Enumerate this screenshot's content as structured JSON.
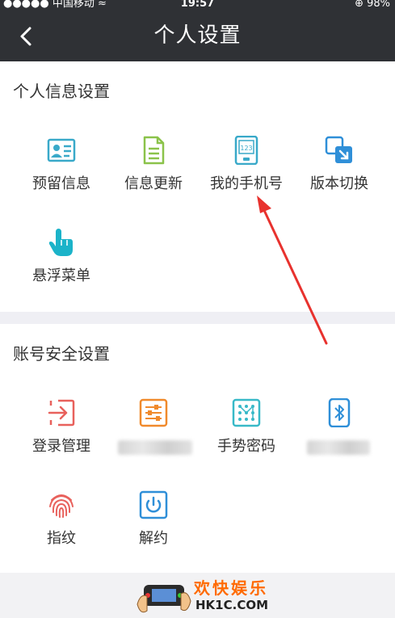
{
  "status_bar": {
    "signal": "●●●●● 中国移动 ≈",
    "time": "19:57",
    "battery": "⊕ 98%"
  },
  "nav": {
    "back_icon": "chevron-left-icon",
    "title": "个人设置"
  },
  "personal_section": {
    "title": "个人信息设置",
    "items": [
      {
        "label": "预留信息",
        "icon": "id-card-icon",
        "color": "#39a9c9"
      },
      {
        "label": "信息更新",
        "icon": "document-icon",
        "color": "#8bc34a"
      },
      {
        "label": "我的手机号",
        "icon": "phone-number-icon",
        "color": "#39a9c9"
      },
      {
        "label": "版本切换",
        "icon": "switch-version-icon",
        "color": "#2f8fd8"
      },
      {
        "label": "悬浮菜单",
        "icon": "hand-pointer-icon",
        "color": "#1bb3c9"
      }
    ]
  },
  "security_section": {
    "title": "账号安全设置",
    "items": [
      {
        "label": "登录管理",
        "icon": "login-icon",
        "color": "#e8615c"
      },
      {
        "label": "",
        "icon": "sliders-icon",
        "color": "#f08a2c"
      },
      {
        "label": "手势密码",
        "icon": "gesture-grid-icon",
        "color": "#38b9c8"
      },
      {
        "label": "",
        "icon": "bluetooth-icon",
        "color": "#2f8fd8"
      },
      {
        "label": "指纹",
        "icon": "fingerprint-icon",
        "color": "#e8615c"
      },
      {
        "label": "解约",
        "icon": "power-icon",
        "color": "#2f8fd8"
      }
    ]
  },
  "watermark": {
    "text": "欢快娱乐",
    "url": "HK1C.COM"
  }
}
